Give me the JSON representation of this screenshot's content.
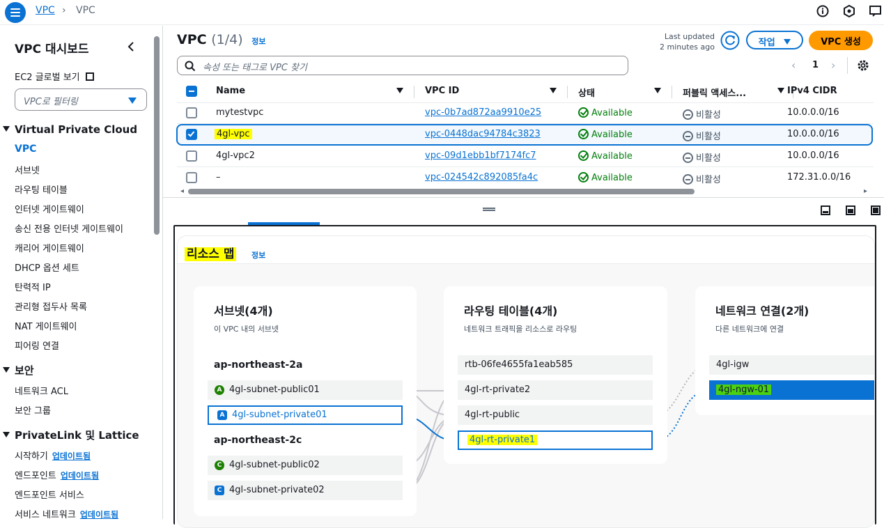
{
  "breadcrumb": {
    "root": "VPC",
    "current": "VPC"
  },
  "sidebar": {
    "title": "VPC 대시보드",
    "ec2_link": "EC2 글로벌 보기",
    "filter_placeholder": "VPC로 필터링",
    "sections": [
      {
        "heading": "Virtual Private Cloud",
        "items": [
          "VPC",
          "서브넷",
          "라우팅 테이블",
          "인터넷 게이트웨이",
          "송신 전용 인터넷 게이트웨이",
          "캐리어 게이트웨이",
          "DHCP 옵션 세트",
          "탄력적 IP",
          "관리형 접두사 목록",
          "NAT 게이트웨이",
          "피어링 연결"
        ]
      },
      {
        "heading": "보안",
        "items": [
          "네트워크 ACL",
          "보안 그룹"
        ]
      },
      {
        "heading": "PrivateLink 및 Lattice",
        "items": [
          "시작하기",
          "엔드포인트",
          "엔드포인트 서비스",
          "서비스 네트워크"
        ]
      }
    ],
    "update_badge": "업데이트됨"
  },
  "header": {
    "title": "VPC",
    "count": "(1/4)",
    "info": "정보",
    "last_updated_label": "Last updated",
    "last_updated_value": "2 minutes ago",
    "actions_label": "작업",
    "create_label": "VPC 생성"
  },
  "search": {
    "placeholder": "속성 또는 태그로 VPC 찾기"
  },
  "pagination": {
    "page": "1"
  },
  "table": {
    "columns": [
      "Name",
      "VPC ID",
      "상태",
      "퍼블릭 액세스...",
      "IPv4 CIDR"
    ],
    "rows": [
      {
        "name": "mytestvpc",
        "id": "vpc-0b7ad872aa9910e25",
        "status": "Available",
        "public": "비활성",
        "cidr": "10.0.0.0/16",
        "selected": false
      },
      {
        "name": "4gl-vpc",
        "id": "vpc-0448dac94784c3823",
        "status": "Available",
        "public": "비활성",
        "cidr": "10.0.0.0/16",
        "selected": true
      },
      {
        "name": "4gl-vpc2",
        "id": "vpc-09d1ebb1bf7174fc7",
        "status": "Available",
        "public": "비활성",
        "cidr": "10.0.0.0/16",
        "selected": false
      },
      {
        "name": "–",
        "id": "vpc-024542c892085fa4c",
        "status": "Available",
        "public": "비활성",
        "cidr": "172.31.0.0/16",
        "selected": false
      }
    ]
  },
  "resource_map": {
    "title": "리소스 맵",
    "info": "정보",
    "subnets": {
      "title": "서브넷(4개)",
      "subtitle": "이 VPC 내의 서브넷",
      "zones": [
        {
          "name": "ap-northeast-2a",
          "items": [
            {
              "badge": "A",
              "label": "4gl-subnet-public01"
            },
            {
              "badge": "A",
              "label": "4gl-subnet-private01"
            }
          ]
        },
        {
          "name": "ap-northeast-2c",
          "items": [
            {
              "badge": "C",
              "label": "4gl-subnet-public02"
            },
            {
              "badge": "C",
              "label": "4gl-subnet-private02"
            }
          ]
        }
      ]
    },
    "route_tables": {
      "title": "라우팅 테이블(4개)",
      "subtitle": "네트워크 트래픽을 리소스로 라우팅",
      "items": [
        "rtb-06fe4655fa1eab585",
        "4gl-rt-private2",
        "4gl-rt-public",
        "4gl-rt-private1"
      ]
    },
    "network": {
      "title": "네트워크 연결(2개)",
      "subtitle": "다른 네트워크에 연결",
      "items": [
        "4gl-igw",
        "4gl-ngw-01"
      ]
    }
  },
  "colors": {
    "accent": "#0972d3",
    "primary_button": "#ff9900",
    "success": "#037f0c",
    "highlight": "#ffff00"
  }
}
